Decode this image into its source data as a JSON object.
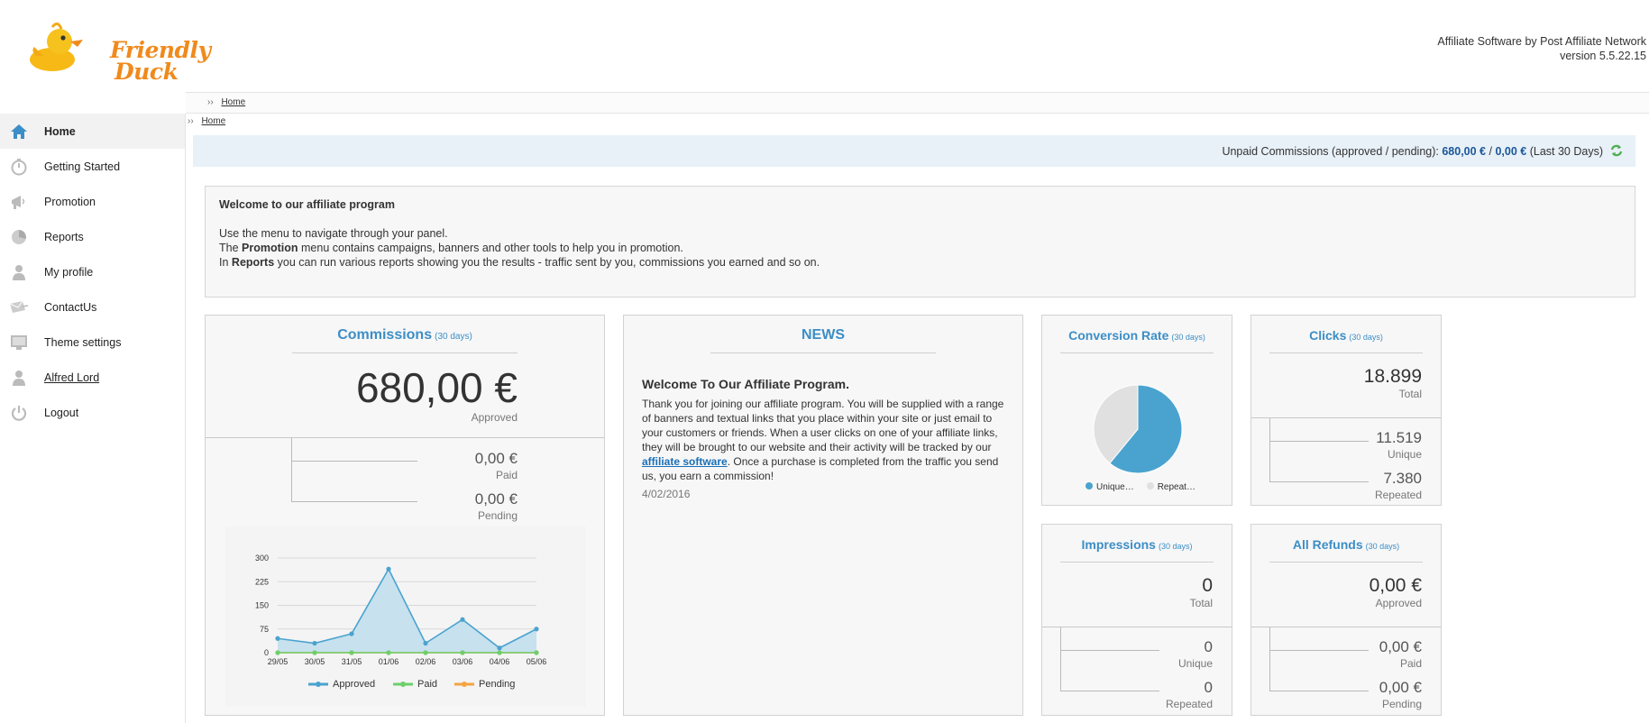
{
  "header": {
    "logo_line1": "Friendly",
    "logo_line2": "Duck",
    "product": "Affiliate Software by Post Affiliate Network",
    "version": "version 5.5.22.15"
  },
  "breadcrumb": {
    "home": "Home"
  },
  "sidebar": {
    "items": [
      {
        "label": "Home",
        "icon": "home-icon"
      },
      {
        "label": "Getting Started",
        "icon": "stopwatch-icon"
      },
      {
        "label": "Promotion",
        "icon": "megaphone-icon"
      },
      {
        "label": "Reports",
        "icon": "pie-chart-icon"
      },
      {
        "label": "My profile",
        "icon": "user-icon"
      },
      {
        "label": "ContactUs",
        "icon": "envelope-icon"
      },
      {
        "label": "Theme settings",
        "icon": "monitor-icon"
      },
      {
        "label": "Alfred Lord",
        "icon": "user-icon"
      },
      {
        "label": "Logout",
        "icon": "power-icon"
      }
    ]
  },
  "commissions_bar": {
    "prefix": "Unpaid Commissions (approved / pending):",
    "approved": "680,00 €",
    "sep": "/",
    "pending": "0,00 €",
    "suffix": "(Last 30 Days)"
  },
  "welcome": {
    "title": "Welcome to our affiliate program",
    "line1": "Use the menu to navigate through your panel.",
    "line2_pre": "The",
    "line2_bold": "Promotion",
    "line2_post": "menu contains campaigns, banners and other tools to help you in promotion.",
    "line3_pre": "In",
    "line3_bold": "Reports",
    "line3_post": "you can run various reports showing you the results - traffic sent by you, commissions you earned and so on."
  },
  "commissions": {
    "title": "Commissions",
    "period": "(30 days)",
    "approved_value": "680,00 €",
    "approved_label": "Approved",
    "paid_value": "0,00 €",
    "paid_label": "Paid",
    "pending_value": "0,00 €",
    "pending_label": "Pending"
  },
  "news": {
    "title": "NEWS",
    "headline": "Welcome To Our Affiliate Program.",
    "body_pre": "Thank you for joining our affiliate program. You will be supplied with a range of banners and textual links that you place within your site or just email to your customers or friends. When a user clicks on one of your affiliate links, they will be brought to our website and their activity will be tracked by our",
    "link": "affiliate software",
    "body_post": ". Once a purchase is completed from the traffic you send us, you earn a commission!",
    "date": "4/02/2016"
  },
  "conversion": {
    "title": "Conversion Rate",
    "period": "(30 days)",
    "legend_unique": "Unique…",
    "legend_repeated": "Repeat…"
  },
  "clicks": {
    "title": "Clicks",
    "period": "(30 days)",
    "total_value": "18.899",
    "total_label": "Total",
    "unique_value": "11.519",
    "unique_label": "Unique",
    "repeated_value": "7.380",
    "repeated_label": "Repeated"
  },
  "impressions": {
    "title": "Impressions",
    "period": "(30 days)",
    "total_value": "0",
    "total_label": "Total",
    "unique_value": "0",
    "unique_label": "Unique",
    "repeated_value": "0",
    "repeated_label": "Repeated"
  },
  "refunds": {
    "title": "All Refunds",
    "period": "(30 days)",
    "approved_value": "0,00 €",
    "approved_label": "Approved",
    "paid_value": "0,00 €",
    "paid_label": "Paid",
    "pending_value": "0,00 €",
    "pending_label": "Pending"
  },
  "colors": {
    "accent": "#3c8ec6",
    "approved_series": "#4aa3cf",
    "paid_series": "#6ccf6c",
    "pending_series": "#f4a442",
    "pie_unique": "#4aa3cf",
    "pie_repeated": "#e0e0e0"
  },
  "chart_data": [
    {
      "type": "area",
      "x": [
        "29/05",
        "30/05",
        "31/05",
        "01/06",
        "02/06",
        "03/06",
        "04/06",
        "05/06"
      ],
      "ylim": [
        0,
        300
      ],
      "yticks": [
        0,
        75,
        150,
        225,
        300
      ],
      "series": [
        {
          "name": "Approved",
          "values": [
            45,
            30,
            60,
            265,
            30,
            105,
            15,
            75
          ]
        },
        {
          "name": "Paid",
          "values": [
            0,
            0,
            0,
            0,
            0,
            0,
            0,
            0
          ]
        },
        {
          "name": "Pending",
          "values": [
            0,
            0,
            0,
            0,
            0,
            0,
            0,
            0
          ]
        }
      ]
    },
    {
      "type": "pie",
      "labels": [
        "Unique…",
        "Repeat…"
      ],
      "values": [
        11519,
        7380
      ]
    }
  ]
}
